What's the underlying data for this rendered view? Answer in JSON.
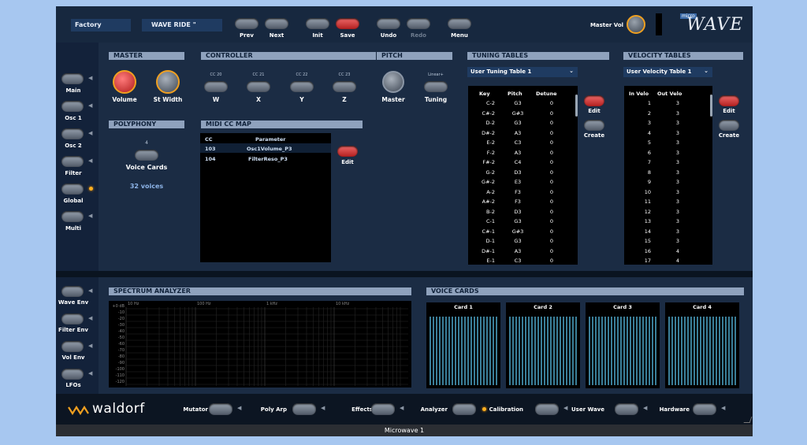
{
  "window": {
    "title": "Microwave 1"
  },
  "toolbar": {
    "bank": "Factory",
    "patch": "WAVE RIDE  \"",
    "buttons": [
      {
        "label": "Prev",
        "dim": false
      },
      {
        "label": "Next",
        "dim": false
      },
      {
        "label": "Init",
        "dim": false
      },
      {
        "label": "Save",
        "dim": false
      },
      {
        "label": "Undo",
        "dim": false
      },
      {
        "label": "Redo",
        "dim": true
      },
      {
        "label": "Menu",
        "dim": false
      }
    ],
    "master_vol": "Master Vol",
    "logo_micro": "micro",
    "logo_wave": "WAVE"
  },
  "sidebar": [
    "Main",
    "Osc 1",
    "Osc 2",
    "Filter",
    "Global",
    "Multi"
  ],
  "sidebar_active": "Global",
  "master": {
    "title": "MASTER",
    "volume": "Volume",
    "st_width": "St Width"
  },
  "controller": {
    "title": "CONTROLLER",
    "items": [
      {
        "cc": "CC 20",
        "label": "W"
      },
      {
        "cc": "CC 21",
        "label": "X"
      },
      {
        "cc": "CC 22",
        "label": "Y"
      },
      {
        "cc": "CC 23",
        "label": "Z"
      }
    ]
  },
  "pitch": {
    "title": "PITCH",
    "master": "Master",
    "mode": "Linear+",
    "tuning": "Tuning"
  },
  "polyphony": {
    "title": "POLYPHONY",
    "count": "4",
    "label": "Voice Cards",
    "voices": "32 voices"
  },
  "midicc": {
    "title": "MIDI CC MAP",
    "col_cc": "CC",
    "col_param": "Parameter",
    "rows": [
      {
        "cc": "103",
        "param": "Osc1Volume_P3"
      },
      {
        "cc": "104",
        "param": "FilterReso_P3"
      }
    ],
    "edit": "Edit"
  },
  "tuning": {
    "title": "TUNING TABLES",
    "selected": "User Tuning Table 1",
    "col_key": "Key",
    "col_pitch": "Pitch",
    "col_detune": "Detune",
    "rows": [
      [
        "C-2",
        "G3",
        "0"
      ],
      [
        "C#-2",
        "G#3",
        "0"
      ],
      [
        "D-2",
        "G3",
        "0"
      ],
      [
        "D#-2",
        "A3",
        "0"
      ],
      [
        "E-2",
        "C3",
        "0"
      ],
      [
        "F-2",
        "A3",
        "0"
      ],
      [
        "F#-2",
        "C4",
        "0"
      ],
      [
        "G-2",
        "D3",
        "0"
      ],
      [
        "G#-2",
        "E3",
        "0"
      ],
      [
        "A-2",
        "F3",
        "0"
      ],
      [
        "A#-2",
        "F3",
        "0"
      ],
      [
        "B-2",
        "D3",
        "0"
      ],
      [
        "C-1",
        "G3",
        "0"
      ],
      [
        "C#-1",
        "G#3",
        "0"
      ],
      [
        "D-1",
        "G3",
        "0"
      ],
      [
        "D#-1",
        "A3",
        "0"
      ],
      [
        "E-1",
        "C3",
        "0"
      ]
    ],
    "edit": "Edit",
    "create": "Create"
  },
  "velocity": {
    "title": "VELOCITY TABLES",
    "selected": "User Velocity Table 1",
    "col_in": "In Velo",
    "col_out": "Out Velo",
    "rows": [
      [
        "1",
        "3"
      ],
      [
        "2",
        "3"
      ],
      [
        "3",
        "3"
      ],
      [
        "4",
        "3"
      ],
      [
        "5",
        "3"
      ],
      [
        "6",
        "3"
      ],
      [
        "7",
        "3"
      ],
      [
        "8",
        "3"
      ],
      [
        "9",
        "3"
      ],
      [
        "10",
        "3"
      ],
      [
        "11",
        "3"
      ],
      [
        "12",
        "3"
      ],
      [
        "13",
        "3"
      ],
      [
        "14",
        "3"
      ],
      [
        "15",
        "3"
      ],
      [
        "16",
        "4"
      ],
      [
        "17",
        "4"
      ]
    ],
    "edit": "Edit",
    "create": "Create"
  },
  "lower_sidebar": [
    "Wave Env",
    "Filter Env",
    "Vol Env",
    "LFOs"
  ],
  "spectrum": {
    "title": "SPECTRUM ANALYZER",
    "freq": [
      "10 Hz",
      "100 Hz",
      "1 kHz",
      "10 kHz"
    ],
    "db": [
      "+0 dB",
      "-10",
      "-20",
      "-30",
      "-40",
      "-50",
      "-60",
      "-70",
      "-80",
      "-90",
      "-100",
      "-110",
      "-120"
    ]
  },
  "voicecards": {
    "title": "VOICE CARDS",
    "cards": [
      "Card 1",
      "Card 2",
      "Card 3",
      "Card 4"
    ]
  },
  "bottom": {
    "brand": "waldorf",
    "items": [
      {
        "label": "Mutator",
        "led": false
      },
      {
        "label": "Poly Arp",
        "led": false
      },
      {
        "label": "Effects",
        "led": false
      },
      {
        "label": "Analyzer",
        "led": true
      },
      {
        "label": "Calibration",
        "led": false
      },
      {
        "label": "User Wave",
        "led": false
      },
      {
        "label": "Hardware",
        "led": false
      }
    ]
  },
  "colors": {
    "accent": "#ffb020",
    "panel": "#0e1b2c",
    "header": "#8fa2bd",
    "red": "#d93030"
  }
}
